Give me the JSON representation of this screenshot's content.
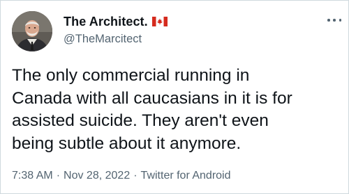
{
  "author": {
    "display_name": "The Architect.",
    "handle": "@TheMarcitect",
    "flag_icon": "canada-flag-icon"
  },
  "tweet": {
    "lines": [
      "The only commercial running in",
      "Canada with all caucasians in it is for",
      "assisted suicide. They aren't even",
      "being subtle about it anymore."
    ],
    "time": "7:38 AM",
    "separator": "·",
    "date": "Nov 28, 2022",
    "source": "Twitter for Android"
  },
  "colors": {
    "text": "#0f1419",
    "secondary": "#536471",
    "flag_red": "#d52b1e"
  }
}
